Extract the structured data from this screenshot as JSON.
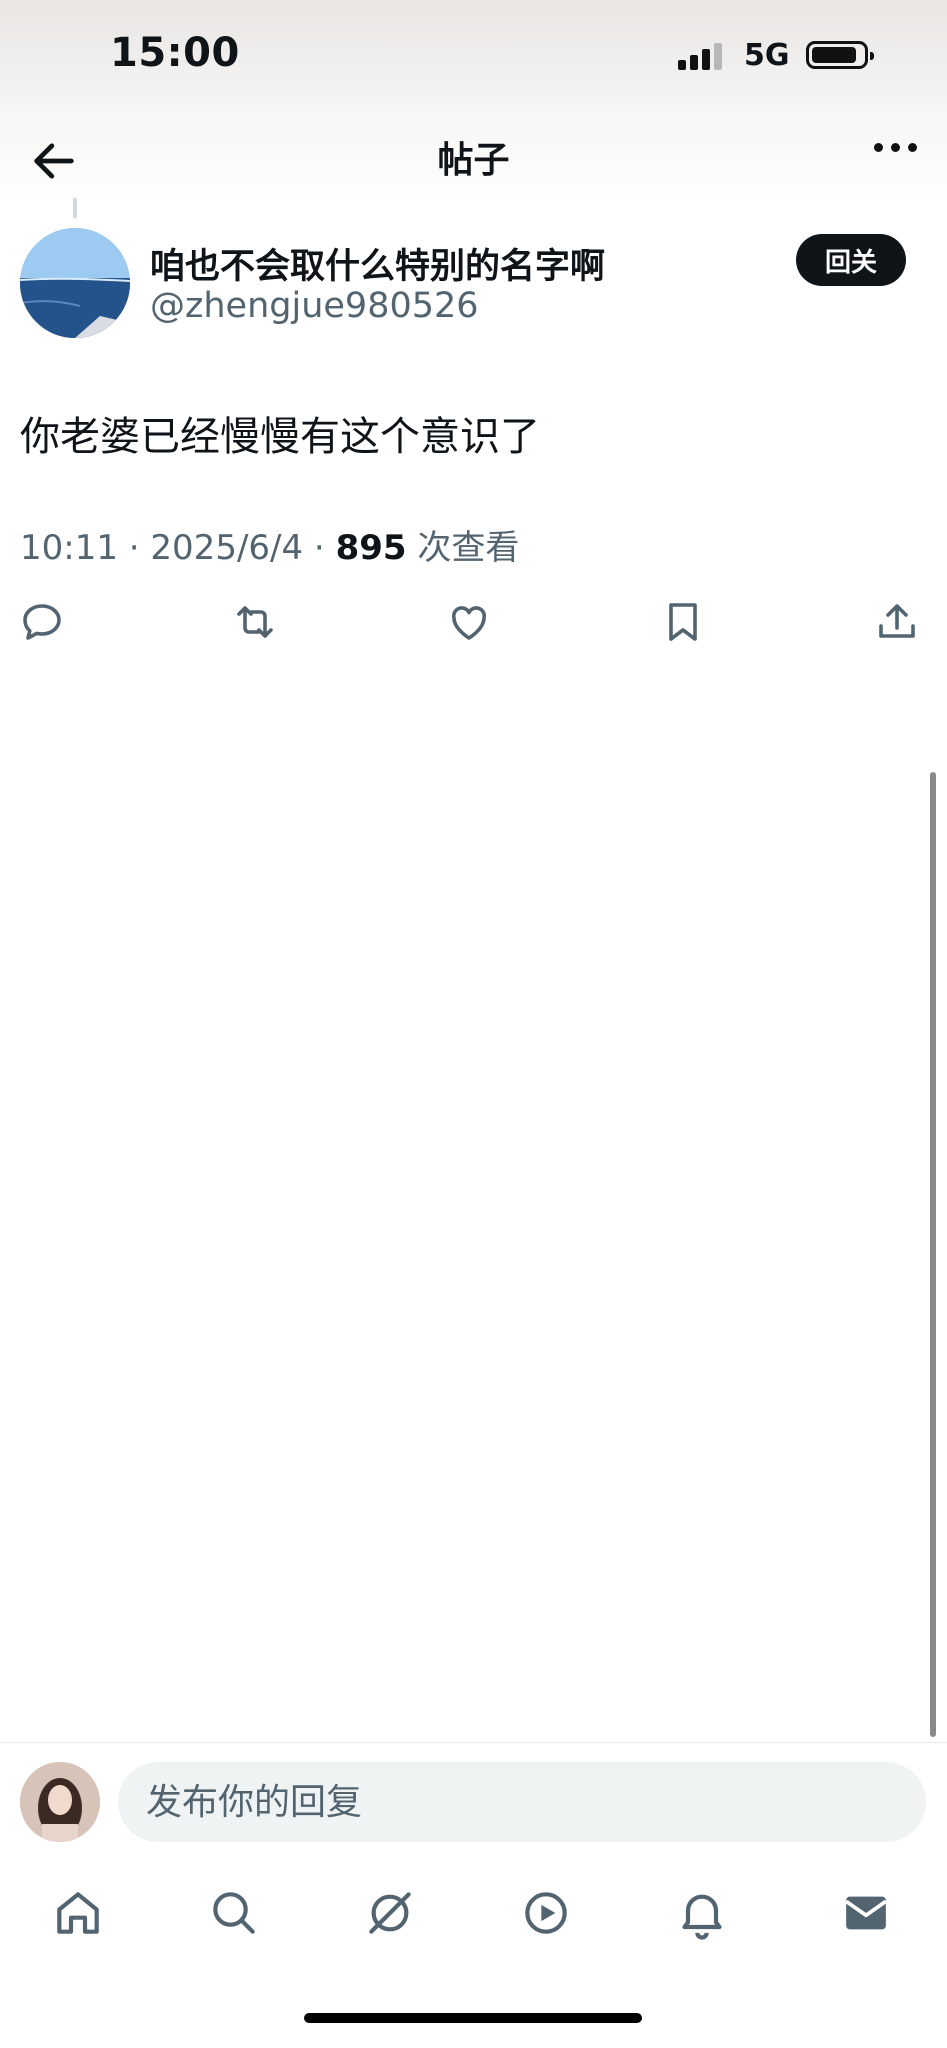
{
  "status_bar": {
    "time": "15:00",
    "network": "5G"
  },
  "nav": {
    "title": "帖子"
  },
  "post": {
    "author_name": "咱也不会取什么特别的名字啊",
    "author_handle": "@zhengjue980526",
    "follow_label": "回关",
    "text": "你老婆已经慢慢有这个意识了",
    "time": "10:11",
    "date": "2025/6/4",
    "views": "895",
    "views_label": "次查看"
  },
  "action_icons": [
    "reply-icon",
    "retweet-icon",
    "like-icon",
    "bookmark-icon",
    "share-icon"
  ],
  "reply": {
    "placeholder": "发布你的回复"
  },
  "tabs": [
    "home-icon",
    "search-icon",
    "grok-icon",
    "video-icon",
    "notifications-icon",
    "messages-icon"
  ]
}
